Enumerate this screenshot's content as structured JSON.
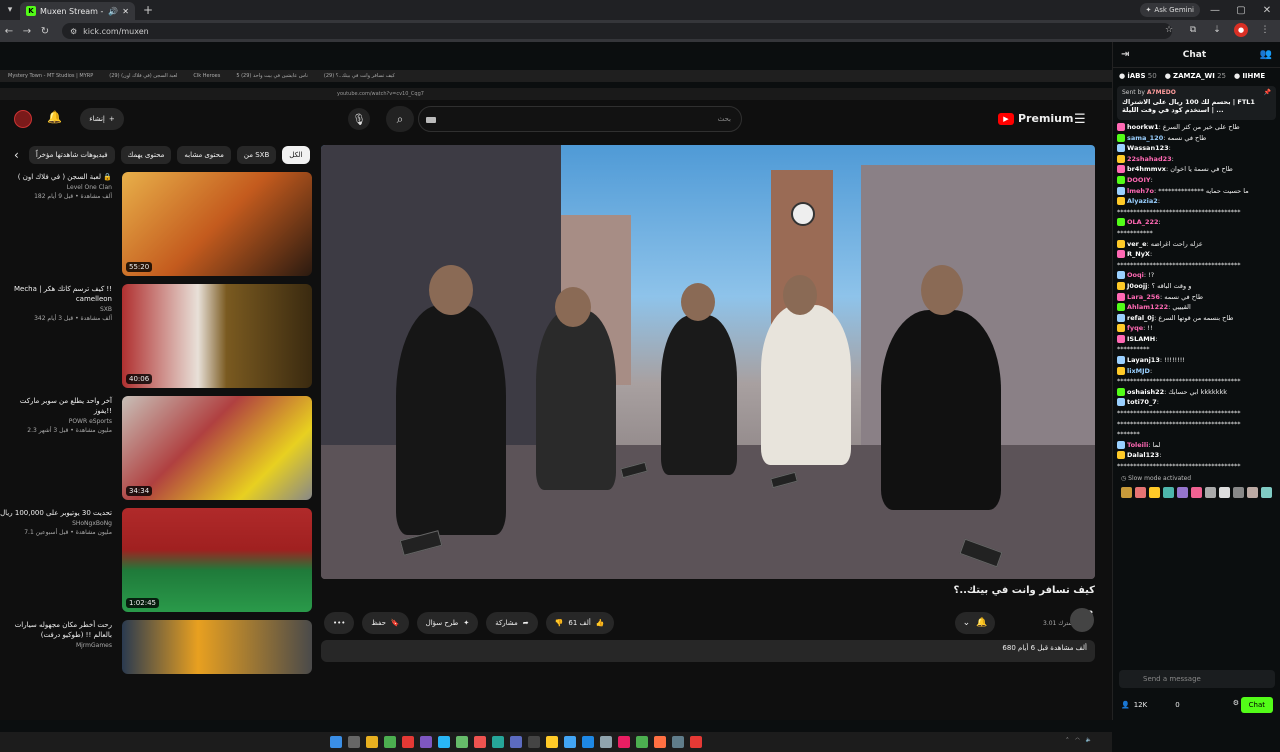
{
  "browser": {
    "tab_title": "Muxen Stream - Watch Live",
    "url": "kick.com/muxen",
    "ask_gemini": "Ask Gemini"
  },
  "inner_browser": {
    "tabs": [
      "Mystery Town - MT Studios | MYRP",
      "لعبة السجن (في فلاك اون) (29)",
      "Clk Heroes",
      "5 ناس عايشين في بيت واحد (29)",
      "كيف تسافر وانت في بيتك..؟ (29)"
    ],
    "url": "youtube.com/watch?v=cv10_Cqg7"
  },
  "youtube": {
    "create_label": "إنشاء",
    "search_placeholder": "بحث",
    "premium_label": "Premium",
    "chips": [
      "الكل",
      "من SXB",
      "محتوى مشابه",
      "محتوى يهمك",
      "فيديوهات شاهدتها مؤخراً"
    ],
    "recommendations": [
      {
        "title": "لعبة السجن ( في فلاك اون ) 🔒",
        "channel": "Level One Clan",
        "stats": "182 ألف مشاهدة • قبل 9 أيام",
        "duration": "55:20"
      },
      {
        "title": "Mecha | كيف ترسم كاتك هكر !! camelleon",
        "channel": "SXB",
        "stats": "342 ألف مشاهدة • قبل 3 أيام",
        "duration": "40:06"
      },
      {
        "title": "آخر واحد يطلع من سوبر ماركت يفوز!!",
        "channel": "POWR eSports",
        "stats": "2.3 مليون مشاهدة • قبل 3 أشهر",
        "duration": "34:34"
      },
      {
        "title": "تحديت 30 يوتيوبر على 100,000 ريال",
        "channel": "SHoNgxBoNg",
        "stats": "7.1 مليون مشاهدة • قبل أسبوعين",
        "duration": "1:02:45"
      },
      {
        "title": "رحت أخطر مكان مجهوله سيارات بالعالم !! (طوكيو درفت)",
        "channel": "MjrmGames",
        "stats": "",
        "duration": ""
      }
    ],
    "video_title": "كيف تسافر وانت في بيتك..؟",
    "channel_name": "SXB",
    "subscribers": "3.01 مليون مشترك",
    "likes": "61 ألف",
    "share": "مشاركة",
    "ask": "طرح سؤال",
    "save": "حفظ",
    "more": "•••",
    "description": "680 ألف مشاهدة قبل 6 أيام"
  },
  "chat": {
    "title": "Chat",
    "gifters": [
      {
        "name": "iABS",
        "count": "50"
      },
      {
        "name": "ZAMZA_WI",
        "count": "25"
      },
      {
        "name": "IIHME",
        "count": ""
      }
    ],
    "pinned": {
      "sent_by": "Sent by",
      "user": "A7MEDO",
      "message": "بحسم لك 100 ريال على الاشتراك | FTL1 استخدم كود في وقت الليلة | ..."
    },
    "messages": [
      {
        "user": "hoorkw1",
        "color": "#ffffff",
        "text": "طاح على خير من كثر السرع"
      },
      {
        "user": "sama_120",
        "color": "#9ad0ff",
        "text": "طاح في نسمه"
      },
      {
        "user": "Wassan123",
        "color": "#ffffff",
        "text": ""
      },
      {
        "user": "22shahad23",
        "color": "#ff69b4",
        "text": ""
      },
      {
        "user": "br4hmmvx",
        "color": "#ffffff",
        "text": "طاح في نسمة يا اخوان"
      },
      {
        "user": "DOOIY",
        "color": "#ff69b4",
        "text": ""
      },
      {
        "user": "lmeh7o",
        "color": "#ff69b4",
        "text": "************** ما حسيت حمايه"
      },
      {
        "user": "Alyazia2",
        "color": "#9ad0ff",
        "text": ""
      },
      {
        "user": "",
        "color": "#ffffff",
        "text": "**************************************"
      },
      {
        "user": "OLA_222",
        "color": "#ff69b4",
        "text": ""
      },
      {
        "user": "",
        "color": "#ffffff",
        "text": "***********"
      },
      {
        "user": "ver_e",
        "color": "#ffffff",
        "text": "عزله راحت اغراضه"
      },
      {
        "user": "R_NyX",
        "color": "#ffffff",
        "text": ""
      },
      {
        "user": "",
        "color": "#ffffff",
        "text": "**************************************"
      },
      {
        "user": "Ooqi",
        "color": "#ff69b4",
        "text": "!?"
      },
      {
        "user": "J0oojj",
        "color": "#ffffff",
        "text": "و وقت الباقه ؟"
      },
      {
        "user": "Lara_256",
        "color": "#ff69b4",
        "text": "طاح في نسمه"
      },
      {
        "user": "Ahlam1222",
        "color": "#ff69b4",
        "text": "القيييي"
      },
      {
        "user": "refal_0j",
        "color": "#ffffff",
        "text": "طاح بنسمه من قوتها السرع"
      },
      {
        "user": "fyqe",
        "color": "#ff69b4",
        "text": "!!"
      },
      {
        "user": "ISLAMH",
        "color": "#ffffff",
        "text": ""
      },
      {
        "user": "",
        "color": "#ffffff",
        "text": "**********"
      },
      {
        "user": "Layanj13",
        "color": "#ffffff",
        "text": "!!!!!!!!"
      },
      {
        "user": "lixMJD",
        "color": "#9ad0ff",
        "text": ""
      },
      {
        "user": "",
        "color": "#ffffff",
        "text": "**************************************"
      },
      {
        "user": "oshaish22",
        "color": "#ffffff",
        "text": "ابي حسابك kkkkkkk"
      },
      {
        "user": "toti70_7",
        "color": "#ffffff",
        "text": ""
      },
      {
        "user": "",
        "color": "#ffffff",
        "text": "**************************************"
      },
      {
        "user": "",
        "color": "#ffffff",
        "text": "**************************************"
      },
      {
        "user": "",
        "color": "#ffffff",
        "text": "*******"
      },
      {
        "user": "Toleili",
        "color": "#ff69b4",
        "text": "لما"
      },
      {
        "user": "Dalal123",
        "color": "#ffffff",
        "text": ""
      },
      {
        "user": "",
        "color": "#ffffff",
        "text": "**************************************"
      }
    ],
    "slow_mode": "Slow mode activated",
    "input_placeholder": "Send a message",
    "viewers": "12K",
    "points": "0",
    "send_label": "Chat"
  },
  "colors": {
    "kick_green": "#53fc18",
    "yt_red": "#ff0000"
  }
}
